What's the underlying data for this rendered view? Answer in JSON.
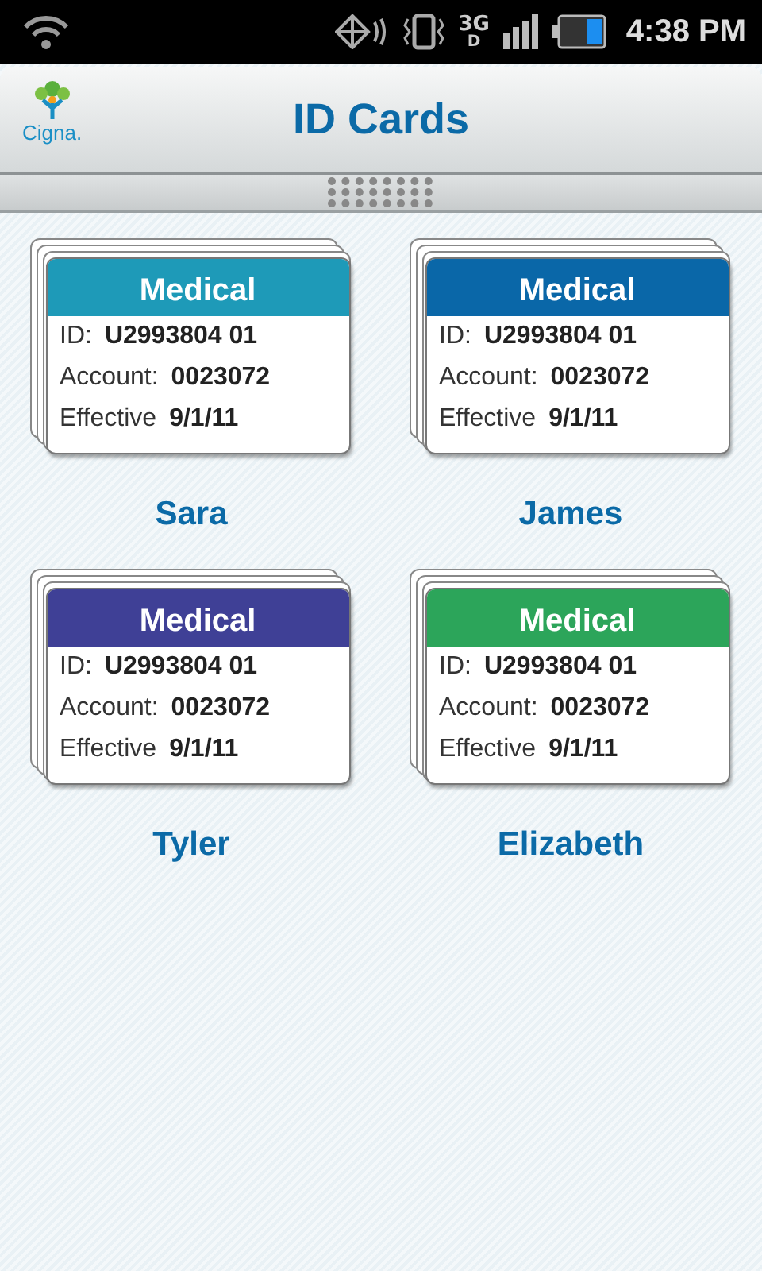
{
  "status_bar": {
    "network": "3G",
    "network_sub": "D",
    "time": "4:38 PM"
  },
  "header": {
    "logo_text": "Cigna.",
    "title": "ID Cards"
  },
  "cards": [
    {
      "plan": "Medical",
      "color": "#1e9ab8",
      "id_label": "ID:",
      "id_value": "U2993804 01",
      "account_label": "Account:",
      "account_value": "0023072",
      "effective_label": "Effective",
      "effective_value": "9/1/11",
      "name": "Sara"
    },
    {
      "plan": "Medical",
      "color": "#0a67a8",
      "id_label": "ID:",
      "id_value": "U2993804 01",
      "account_label": "Account:",
      "account_value": "0023072",
      "effective_label": "Effective",
      "effective_value": "9/1/11",
      "name": "James"
    },
    {
      "plan": "Medical",
      "color": "#3f4096",
      "id_label": "ID:",
      "id_value": "U2993804 01",
      "account_label": "Account:",
      "account_value": "0023072",
      "effective_label": "Effective",
      "effective_value": "9/1/11",
      "name": "Tyler"
    },
    {
      "plan": "Medical",
      "color": "#2ca55a",
      "id_label": "ID:",
      "id_value": "U2993804 01",
      "account_label": "Account:",
      "account_value": "0023072",
      "effective_label": "Effective",
      "effective_value": "9/1/11",
      "name": "Elizabeth"
    }
  ]
}
